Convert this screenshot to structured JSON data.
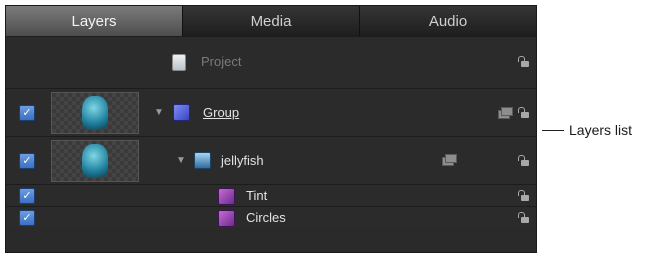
{
  "tabs": [
    {
      "label": "Layers",
      "active": true
    },
    {
      "label": "Media",
      "active": false
    },
    {
      "label": "Audio",
      "active": false
    }
  ],
  "layers": {
    "project": {
      "label": "Project",
      "icon": "document-icon"
    },
    "group": {
      "label": "Group",
      "checked": true,
      "icon": "group-icon"
    },
    "jellyfish": {
      "label": "jellyfish",
      "checked": true,
      "icon": "image-icon"
    },
    "tint": {
      "label": "Tint",
      "checked": true,
      "icon": "filter-icon"
    },
    "circles": {
      "label": "Circles",
      "checked": true,
      "icon": "filter-icon"
    }
  },
  "callout": {
    "label": "Layers list"
  },
  "colors": {
    "active_tab": "#6a6a6a",
    "panel_bg": "#2b2b2b",
    "checkbox": "#4a7fd0"
  }
}
